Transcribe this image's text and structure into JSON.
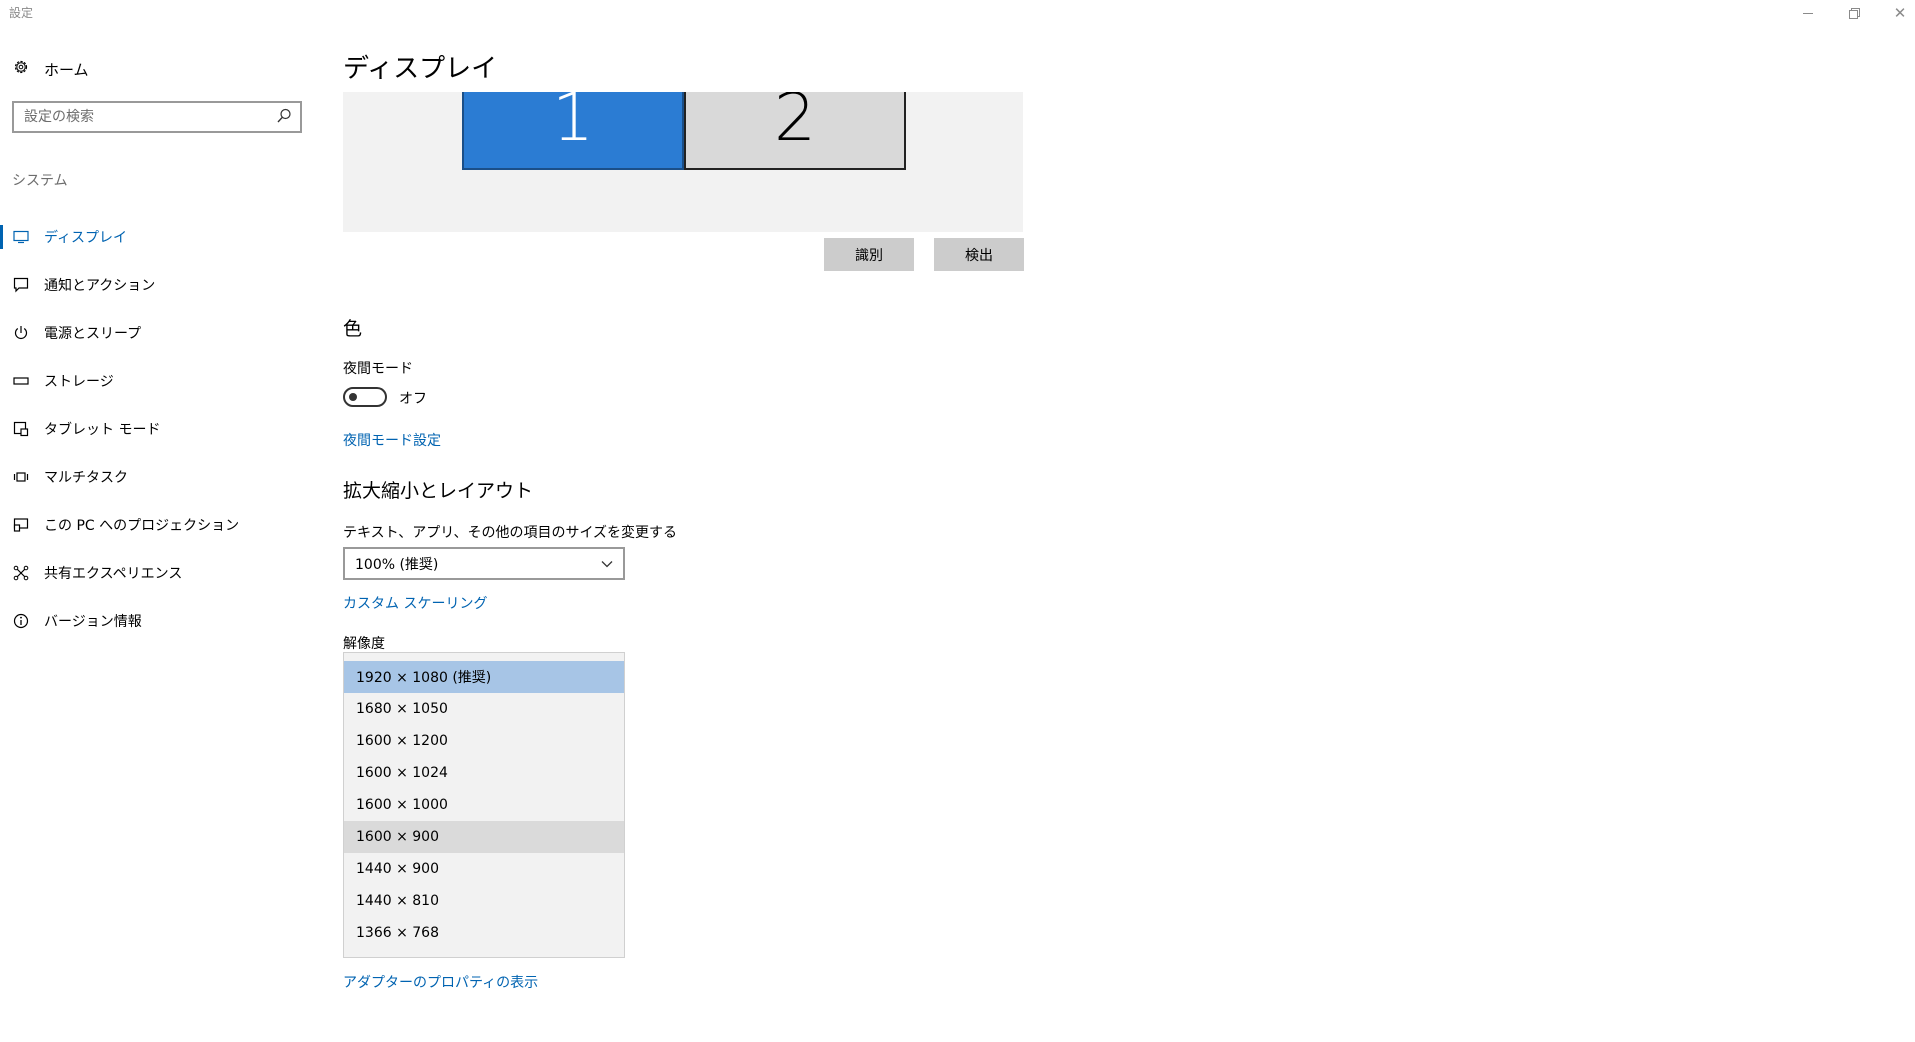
{
  "window": {
    "title": "設定",
    "minimize_icon": "minimize-icon",
    "maximize_icon": "restore-icon",
    "close_icon": "close-icon",
    "close_glyph": "✕"
  },
  "sidebar": {
    "home_label": "ホーム",
    "search_placeholder": "設定の検索",
    "section_label": "システム",
    "items": [
      {
        "label": "ディスプレイ",
        "icon": "display-icon",
        "active": true
      },
      {
        "label": "通知とアクション",
        "icon": "notification-icon",
        "active": false
      },
      {
        "label": "電源とスリープ",
        "icon": "power-icon",
        "active": false
      },
      {
        "label": "ストレージ",
        "icon": "storage-icon",
        "active": false
      },
      {
        "label": "タブレット モード",
        "icon": "tablet-icon",
        "active": false
      },
      {
        "label": "マルチタスク",
        "icon": "multitask-icon",
        "active": false
      },
      {
        "label": "この PC へのプロジェクション",
        "icon": "projection-icon",
        "active": false
      },
      {
        "label": "共有エクスペリエンス",
        "icon": "shared-experience-icon",
        "active": false
      },
      {
        "label": "バージョン情報",
        "icon": "info-icon",
        "active": false
      }
    ]
  },
  "main": {
    "title": "ディスプレイ",
    "monitors": [
      {
        "label": "1",
        "color": "#2b7cd3",
        "selected": true
      },
      {
        "label": "2",
        "color": "#d9d9d9",
        "selected": false
      }
    ],
    "identify_button": "識別",
    "detect_button": "検出",
    "color_section": {
      "heading": "色",
      "night_mode_label": "夜間モード",
      "night_mode_state": "オフ",
      "night_mode_on": false,
      "night_mode_settings_link": "夜間モード設定"
    },
    "scale_section": {
      "heading": "拡大縮小とレイアウト",
      "size_label": "テキスト、アプリ、その他の項目のサイズを変更する",
      "size_value": "100% (推奨)",
      "custom_scaling_link": "カスタム スケーリング",
      "resolution_label": "解像度",
      "resolution_options": [
        "1920 × 1080 (推奨)",
        "1680 × 1050",
        "1600 × 1200",
        "1600 × 1024",
        "1600 × 1000",
        "1600 × 900",
        "1440 × 900",
        "1440 × 810",
        "1366 × 768"
      ],
      "resolution_selected_index": 0,
      "resolution_hover_index": 5,
      "adapter_properties_link": "アダプターのプロパティの表示"
    }
  },
  "colors": {
    "accent": "#0063b1",
    "selected_option": "#a7c5e6",
    "hover_option": "#dadada",
    "monitor_primary": "#2b7cd3"
  }
}
